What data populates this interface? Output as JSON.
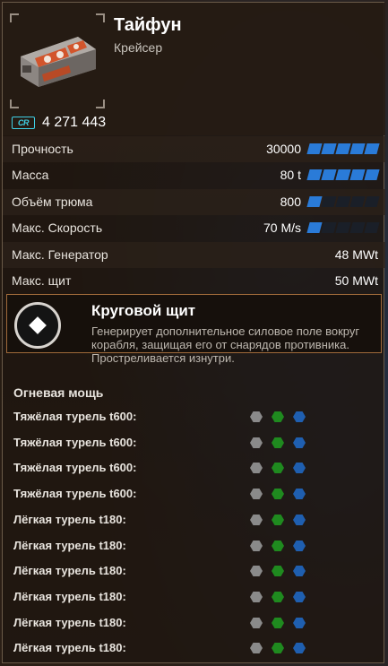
{
  "ship": {
    "name": "Тайфун",
    "class": "Крейсер",
    "currency_label": "CR",
    "price": "4 271 443"
  },
  "stats": [
    {
      "label": "Прочность",
      "value": "30000",
      "bar_filled": 5,
      "bar_total": 5
    },
    {
      "label": "Масса",
      "value": "80 t",
      "bar_filled": 5,
      "bar_total": 5
    },
    {
      "label": "Объём трюма",
      "value": "800",
      "bar_filled": 1,
      "bar_total": 5
    },
    {
      "label": "Макс. Скорость",
      "value": "70 M/s",
      "bar_filled": 1,
      "bar_total": 5
    },
    {
      "label": "Макс. Генератор",
      "value": "48 MWt"
    },
    {
      "label": "Макс. щит",
      "value": "50 MWt"
    }
  ],
  "ability": {
    "title": "Круговой щит",
    "description": "Генерирует дополнительное силовое поле вокруг корабля, защищая его от снарядов противника. Простреливается изнутри."
  },
  "firepower": {
    "header": "Огневая мощь",
    "weapons": [
      "Тяжёлая турель t600:",
      "Тяжёлая турель t600:",
      "Тяжёлая турель t600:",
      "Тяжёлая турель t600:",
      "Лёгкая турель t180:",
      "Лёгкая турель t180:",
      "Лёгкая турель t180:",
      "Лёгкая турель t180:",
      "Лёгкая турель t180:",
      "Лёгкая турель t180:"
    ]
  },
  "colors": {
    "bar_active": "#2a7bd8",
    "bar_inactive": "#1a1f28",
    "hex_gray": "#8a8a8a",
    "hex_green": "#1f8a1f",
    "hex_blue": "#1f5fb0",
    "accent_cyan": "#3fd0e6"
  }
}
